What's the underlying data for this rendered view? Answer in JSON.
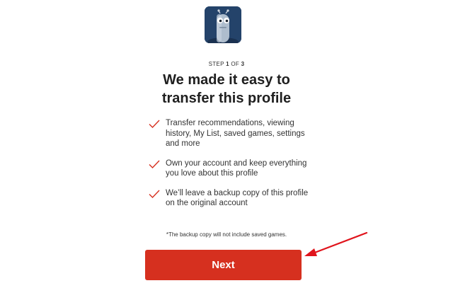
{
  "profile": {
    "avatar_icon": "robot-avatar-icon"
  },
  "step": {
    "prefix": "STEP",
    "current": "1",
    "separator": "OF",
    "total": "3"
  },
  "heading": {
    "line1": "We made it easy to",
    "line2": "transfer this profile"
  },
  "benefits": [
    {
      "icon": "checkmark-icon",
      "text": "Transfer recommendations, viewing history, My List, saved games, settings and more"
    },
    {
      "icon": "checkmark-icon",
      "text": "Own your account and keep everything you love about this profile"
    },
    {
      "icon": "checkmark-icon",
      "text": "We’ll leave a backup copy of this profile on the original account"
    }
  ],
  "footnote": "*The backup copy will not include saved games.",
  "next_button": {
    "label": "Next"
  },
  "colors": {
    "accent": "#d6301f",
    "check": "#d6301f",
    "annotation_arrow": "#e0141c"
  }
}
